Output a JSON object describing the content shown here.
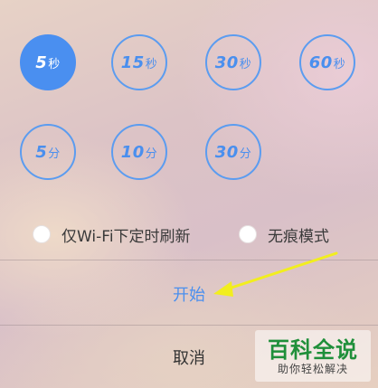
{
  "timers": {
    "t5s": {
      "num": "5",
      "unit": "秒"
    },
    "t15s": {
      "num": "15",
      "unit": "秒"
    },
    "t30s": {
      "num": "30",
      "unit": "秒"
    },
    "t60s": {
      "num": "60",
      "unit": "秒"
    },
    "t5m": {
      "num": "5",
      "unit": "分"
    },
    "t10m": {
      "num": "10",
      "unit": "分"
    },
    "t30m": {
      "num": "30",
      "unit": "分"
    },
    "selected": "5秒"
  },
  "options": {
    "wifi_only": "仅Wi-Fi下定时刷新",
    "incognito": "无痕模式"
  },
  "actions": {
    "start": "开始",
    "cancel": "取消"
  },
  "watermark": {
    "title": "百科全说",
    "subtitle": "助你轻松解决"
  },
  "colors": {
    "accent": "#4a8ff0",
    "arrow": "#f2ee1e",
    "watermark_green": "#1f8f3a"
  }
}
